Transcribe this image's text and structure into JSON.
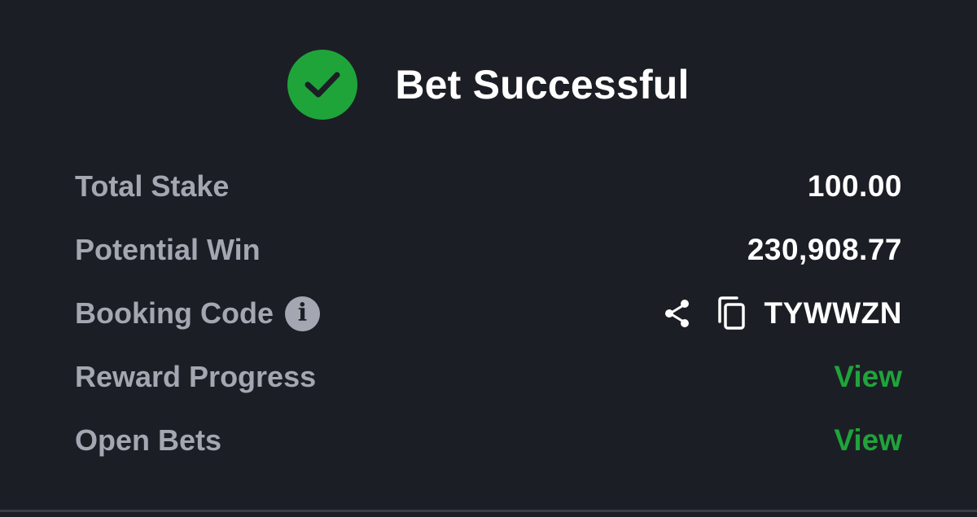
{
  "header": {
    "title": "Bet Successful",
    "status_icon": "check-circle-icon",
    "accent_color": "#1fa43a"
  },
  "details": {
    "total_stake": {
      "label": "Total Stake",
      "value": "100.00"
    },
    "potential_win": {
      "label": "Potential Win",
      "value": "230,908.77"
    },
    "booking_code": {
      "label": "Booking Code",
      "info_icon_glyph": "i",
      "value": "TYWWZN",
      "icons": [
        "share-icon",
        "copy-icon"
      ]
    },
    "reward_progress": {
      "label": "Reward Progress",
      "link": "View"
    },
    "open_bets": {
      "label": "Open Bets",
      "link": "View"
    }
  },
  "colors": {
    "background": "#1c1e25",
    "label": "#a4a7b1",
    "value": "#ffffff",
    "link": "#1fa43a"
  }
}
